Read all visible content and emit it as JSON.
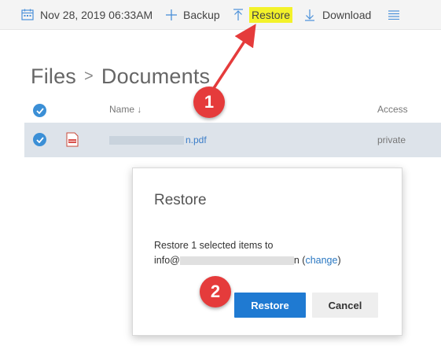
{
  "toolbar": {
    "date": "Nov 28, 2019 06:33AM",
    "backup_label": "Backup",
    "restore_label": "Restore",
    "download_label": "Download",
    "highlight_color": "#f3f22a"
  },
  "breadcrumb": {
    "root": "Files",
    "separator": ">",
    "current": "Documents"
  },
  "table": {
    "columns": {
      "name": "Name ↓",
      "access": "Access"
    },
    "rows": [
      {
        "name_suffix": "n.pdf",
        "access": "private",
        "selected": true,
        "icon": "pdf-file-icon"
      }
    ]
  },
  "dialog": {
    "title": "Restore",
    "line1": "Restore 1 selected items to",
    "line2_prefix": "info@",
    "line2_suffix": "n (",
    "change_link": "change",
    "line2_end": ")",
    "restore_button": "Restore",
    "cancel_button": "Cancel"
  },
  "annotations": {
    "step1": "1",
    "step2": "2",
    "color": "#e53b3b"
  }
}
